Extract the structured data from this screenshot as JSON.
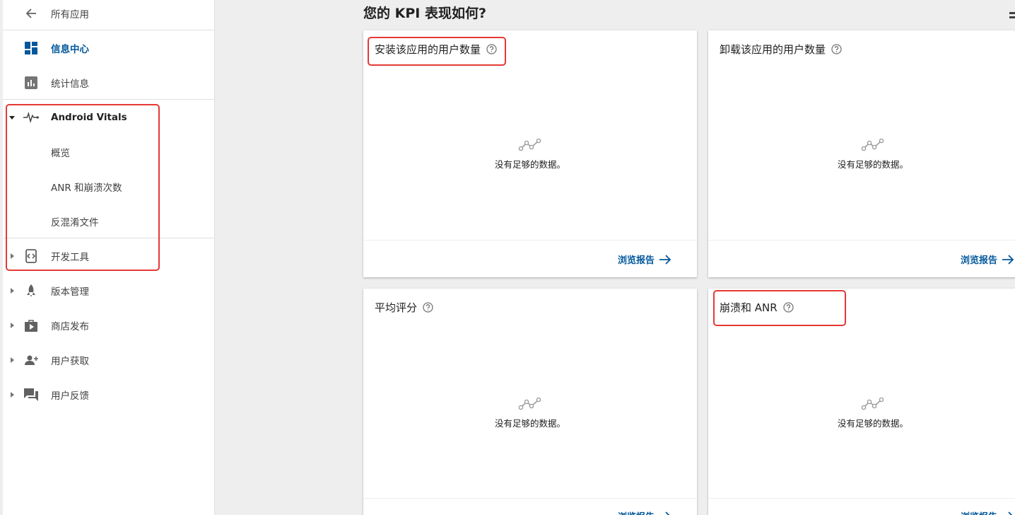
{
  "sidebar": {
    "back_label": "所有应用",
    "dashboard_label": "信息中心",
    "statistics_label": "统计信息",
    "vitals_label": "Android Vitals",
    "vitals_overview_label": "概览",
    "vitals_anr_label": "ANR 和崩溃次数",
    "vitals_deobfuscation_label": "反混淆文件",
    "dev_tools_label": "开发工具",
    "release_label": "版本管理",
    "store_label": "商店发布",
    "acquisition_label": "用户获取",
    "feedback_label": "用户反馈"
  },
  "main": {
    "title": "您的 KPI 表现如何?",
    "cards": [
      {
        "title": "安装该应用的用户数量",
        "empty_text": "没有足够的数据。",
        "link_label": "浏览报告"
      },
      {
        "title": "卸载该应用的用户数量",
        "empty_text": "没有足够的数据。",
        "link_label": "浏览报告"
      },
      {
        "title": "平均评分",
        "empty_text": "没有足够的数据。",
        "link_label": "浏览报告"
      },
      {
        "title": "崩溃和 ANR",
        "empty_text": "没有足够的数据。",
        "link_label": "浏览报告"
      }
    ]
  },
  "icons": {
    "back": "arrow-left-icon",
    "dashboard": "dashboard-icon",
    "statistics": "bar-chart-icon",
    "vitals": "pulse-icon",
    "dev_tools": "code-braces-icon",
    "release": "rocket-icon",
    "store": "store-play-icon",
    "acquisition": "add-user-icon",
    "feedback": "chat-icon",
    "help": "help-circle-icon",
    "empty_chart": "line-chart-icon",
    "arrow": "arrow-right-icon"
  },
  "colors": {
    "accent": "#01579b",
    "highlight_box": "#e53935",
    "sidebar_bg": "#ffffff",
    "main_bg": "#eeeeee"
  }
}
